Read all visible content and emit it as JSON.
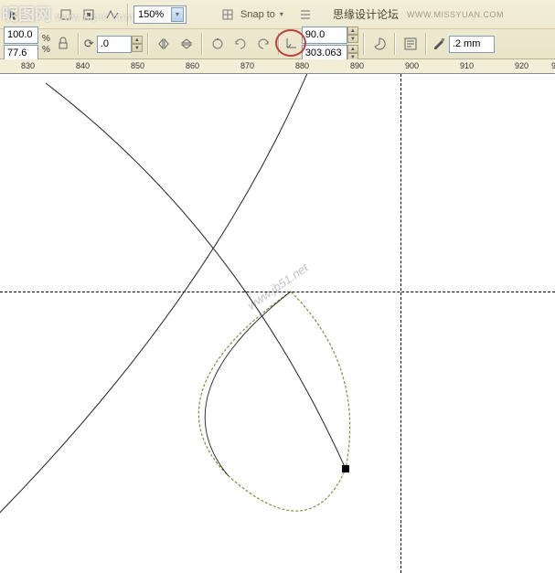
{
  "watermark_site": "昵图网",
  "watermark_url": "www.nipic.com",
  "toolbar": {
    "zoom_value": "150%",
    "snap_label": "Snap to",
    "forum_label": "思缘设计论坛",
    "forum_url": "WWW.MISSYUAN.COM",
    "scale_x": "100.0",
    "scale_y": "77.6",
    "pct_symbol": "%",
    "rotation_angle_input": ".0",
    "angle_value": "90.0",
    "angle_step": "303.063",
    "outline_width": ".2 mm"
  },
  "ruler": {
    "ticks": [
      "830",
      "840",
      "850",
      "860",
      "870",
      "880",
      "890",
      "900",
      "910",
      "920",
      "9"
    ]
  },
  "canvas_watermark": "www.jb51.net"
}
